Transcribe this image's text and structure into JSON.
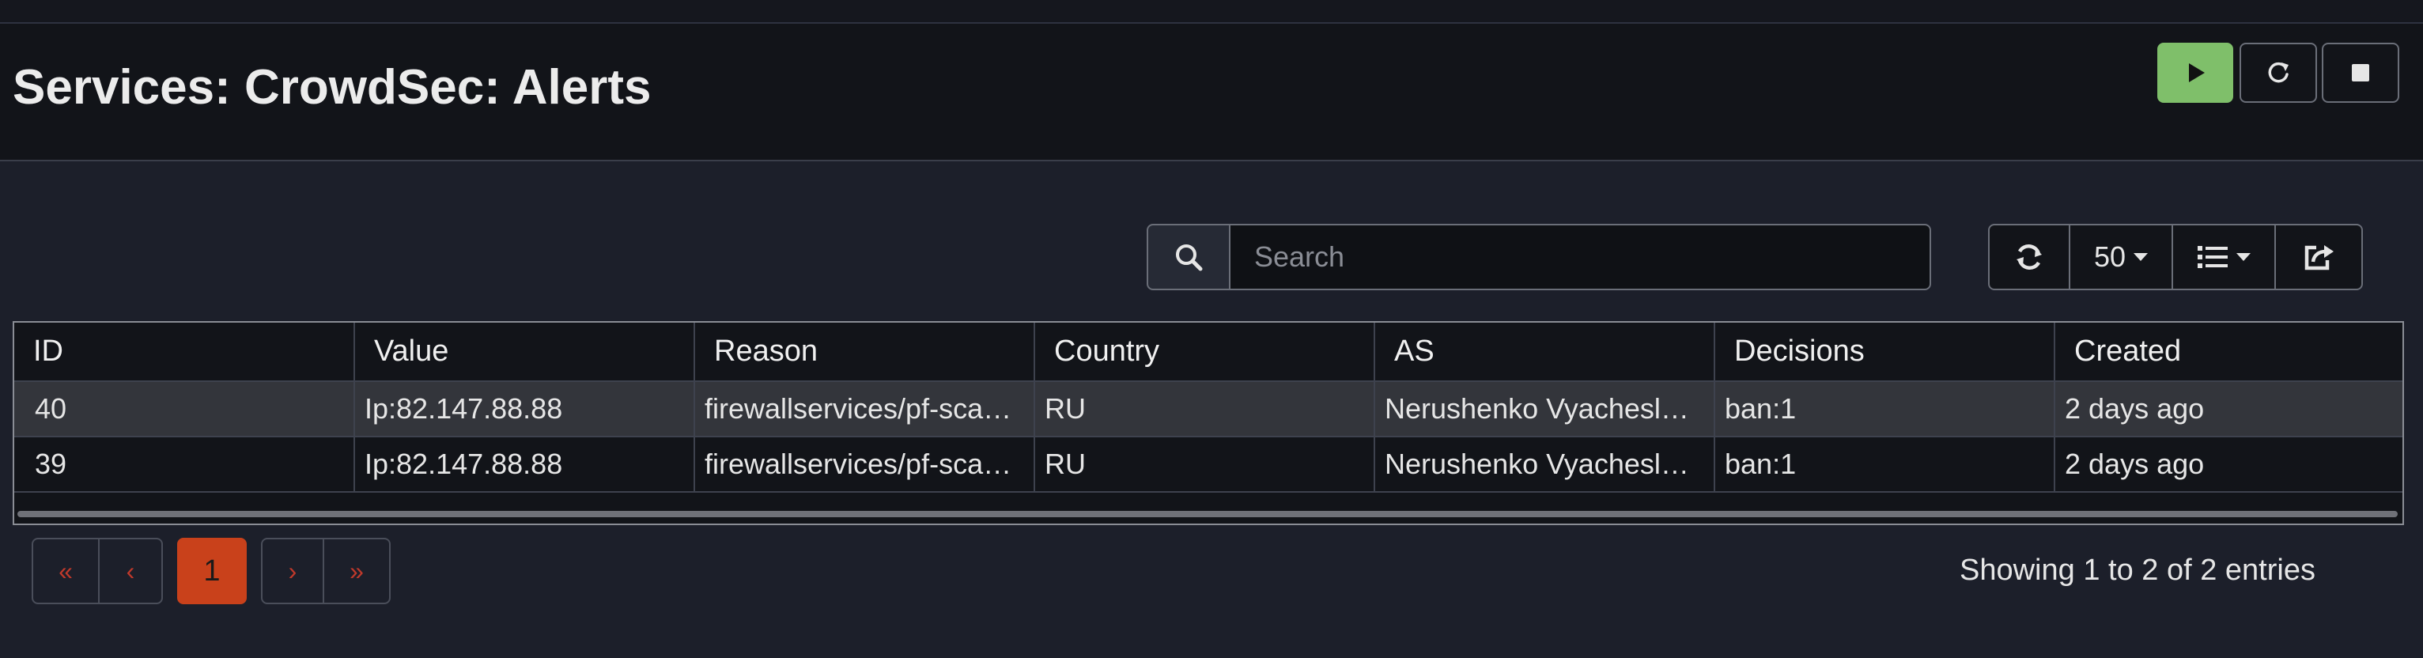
{
  "page": {
    "title": "Services: CrowdSec: Alerts"
  },
  "header_buttons": {
    "start": "play-icon",
    "restart": "reload-icon",
    "stop": "stop-icon",
    "start_color": "#7fbf6a"
  },
  "search": {
    "placeholder": "Search",
    "value": ""
  },
  "toolbar": {
    "refresh": "refresh-icon",
    "page_size": "50",
    "columns": "list-icon",
    "export": "export-icon"
  },
  "table": {
    "columns": [
      "ID",
      "Value",
      "Reason",
      "Country",
      "AS",
      "Decisions",
      "Created"
    ],
    "rows": [
      [
        "40",
        "Ip:82.147.88.88",
        "firewallservices/pf-sca…",
        "RU",
        "Nerushenko Vyachesla…",
        "ban:1",
        "2 days ago"
      ],
      [
        "39",
        "Ip:82.147.88.88",
        "firewallservices/pf-sca…",
        "RU",
        "Nerushenko Vyachesla…",
        "ban:1",
        "2 days ago"
      ]
    ]
  },
  "pagination": {
    "first": "«",
    "prev": "‹",
    "current": "1",
    "next": "›",
    "last": "»",
    "current_color": "#c9411b"
  },
  "status": {
    "showing": "Showing 1 to 2 of 2 entries"
  }
}
